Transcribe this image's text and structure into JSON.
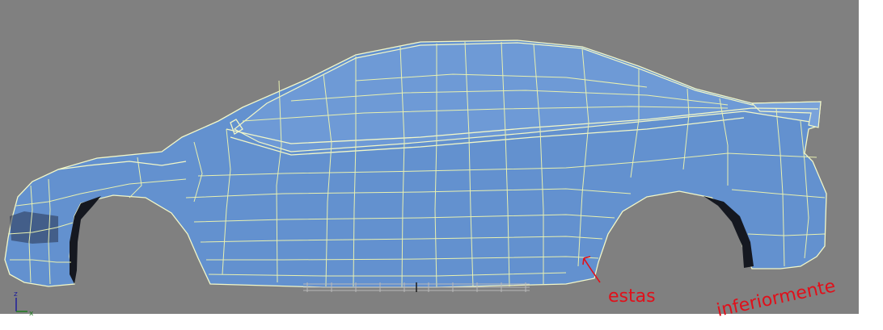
{
  "viewport": {
    "background": "#808080",
    "model_fill": "#6391cf",
    "wire_color": "#e8f0b0"
  },
  "gizmo": {
    "axis_z_label": "z",
    "axis_x_label": "x"
  },
  "annotation": {
    "color": "#e0101a",
    "line1": "estas",
    "line2": "inferiormente",
    "arrow_icon": "arrow-icon"
  }
}
